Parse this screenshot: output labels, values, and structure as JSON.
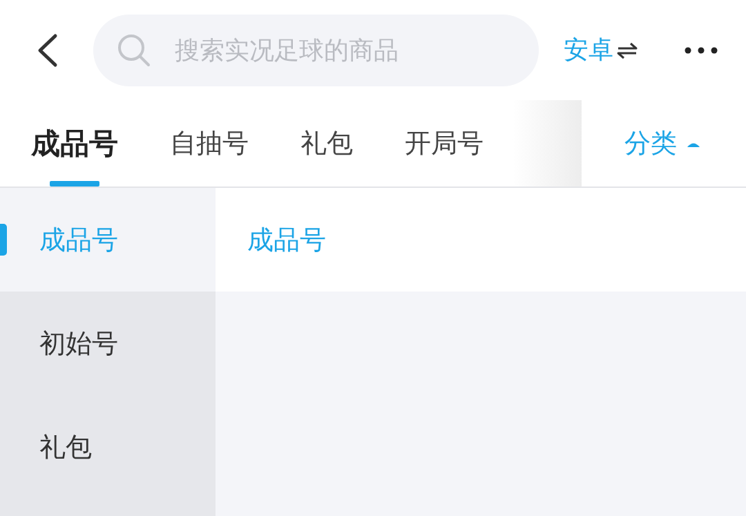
{
  "header": {
    "search": {
      "placeholder": "搜索实况足球的商品"
    },
    "platform": "安卓"
  },
  "tabs": [
    {
      "label": "成品号",
      "selected": true
    },
    {
      "label": "自抽号",
      "selected": false
    },
    {
      "label": "礼包",
      "selected": false
    },
    {
      "label": "开局号",
      "selected": false
    }
  ],
  "category_button": {
    "label": "分类",
    "expanded": true
  },
  "sidebar": {
    "items": [
      {
        "label": "成品号",
        "selected": true
      },
      {
        "label": "初始号",
        "selected": false
      },
      {
        "label": "礼包",
        "selected": false
      }
    ]
  },
  "content": {
    "section_title": "成品号"
  }
}
